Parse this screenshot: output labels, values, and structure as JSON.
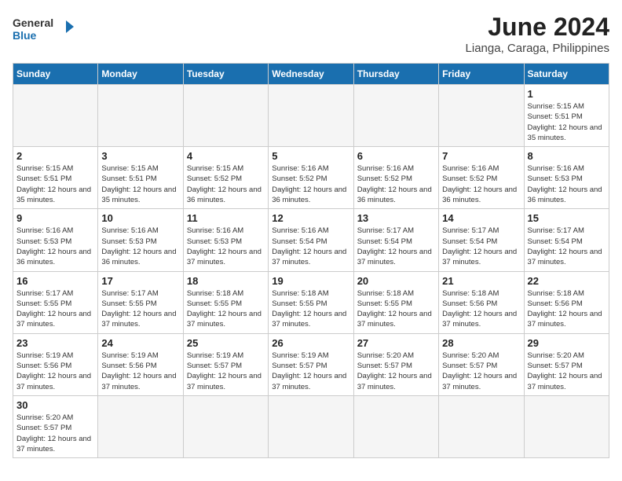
{
  "logo": {
    "text_general": "General",
    "text_blue": "Blue"
  },
  "title": "June 2024",
  "subtitle": "Lianga, Caraga, Philippines",
  "weekdays": [
    "Sunday",
    "Monday",
    "Tuesday",
    "Wednesday",
    "Thursday",
    "Friday",
    "Saturday"
  ],
  "weeks": [
    [
      {
        "day": "",
        "empty": true
      },
      {
        "day": "",
        "empty": true
      },
      {
        "day": "",
        "empty": true
      },
      {
        "day": "",
        "empty": true
      },
      {
        "day": "",
        "empty": true
      },
      {
        "day": "",
        "empty": true
      },
      {
        "day": "1",
        "sunrise": "5:15 AM",
        "sunset": "5:51 PM",
        "daylight": "12 hours and 35 minutes."
      }
    ],
    [
      {
        "day": "2",
        "sunrise": "5:15 AM",
        "sunset": "5:51 PM",
        "daylight": "12 hours and 35 minutes."
      },
      {
        "day": "3",
        "sunrise": "5:15 AM",
        "sunset": "5:51 PM",
        "daylight": "12 hours and 35 minutes."
      },
      {
        "day": "4",
        "sunrise": "5:15 AM",
        "sunset": "5:52 PM",
        "daylight": "12 hours and 36 minutes."
      },
      {
        "day": "5",
        "sunrise": "5:16 AM",
        "sunset": "5:52 PM",
        "daylight": "12 hours and 36 minutes."
      },
      {
        "day": "6",
        "sunrise": "5:16 AM",
        "sunset": "5:52 PM",
        "daylight": "12 hours and 36 minutes."
      },
      {
        "day": "7",
        "sunrise": "5:16 AM",
        "sunset": "5:52 PM",
        "daylight": "12 hours and 36 minutes."
      },
      {
        "day": "8",
        "sunrise": "5:16 AM",
        "sunset": "5:53 PM",
        "daylight": "12 hours and 36 minutes."
      }
    ],
    [
      {
        "day": "9",
        "sunrise": "5:16 AM",
        "sunset": "5:53 PM",
        "daylight": "12 hours and 36 minutes."
      },
      {
        "day": "10",
        "sunrise": "5:16 AM",
        "sunset": "5:53 PM",
        "daylight": "12 hours and 36 minutes."
      },
      {
        "day": "11",
        "sunrise": "5:16 AM",
        "sunset": "5:53 PM",
        "daylight": "12 hours and 37 minutes."
      },
      {
        "day": "12",
        "sunrise": "5:16 AM",
        "sunset": "5:54 PM",
        "daylight": "12 hours and 37 minutes."
      },
      {
        "day": "13",
        "sunrise": "5:17 AM",
        "sunset": "5:54 PM",
        "daylight": "12 hours and 37 minutes."
      },
      {
        "day": "14",
        "sunrise": "5:17 AM",
        "sunset": "5:54 PM",
        "daylight": "12 hours and 37 minutes."
      },
      {
        "day": "15",
        "sunrise": "5:17 AM",
        "sunset": "5:54 PM",
        "daylight": "12 hours and 37 minutes."
      }
    ],
    [
      {
        "day": "16",
        "sunrise": "5:17 AM",
        "sunset": "5:55 PM",
        "daylight": "12 hours and 37 minutes."
      },
      {
        "day": "17",
        "sunrise": "5:17 AM",
        "sunset": "5:55 PM",
        "daylight": "12 hours and 37 minutes."
      },
      {
        "day": "18",
        "sunrise": "5:18 AM",
        "sunset": "5:55 PM",
        "daylight": "12 hours and 37 minutes."
      },
      {
        "day": "19",
        "sunrise": "5:18 AM",
        "sunset": "5:55 PM",
        "daylight": "12 hours and 37 minutes."
      },
      {
        "day": "20",
        "sunrise": "5:18 AM",
        "sunset": "5:55 PM",
        "daylight": "12 hours and 37 minutes."
      },
      {
        "day": "21",
        "sunrise": "5:18 AM",
        "sunset": "5:56 PM",
        "daylight": "12 hours and 37 minutes."
      },
      {
        "day": "22",
        "sunrise": "5:18 AM",
        "sunset": "5:56 PM",
        "daylight": "12 hours and 37 minutes."
      }
    ],
    [
      {
        "day": "23",
        "sunrise": "5:19 AM",
        "sunset": "5:56 PM",
        "daylight": "12 hours and 37 minutes."
      },
      {
        "day": "24",
        "sunrise": "5:19 AM",
        "sunset": "5:56 PM",
        "daylight": "12 hours and 37 minutes."
      },
      {
        "day": "25",
        "sunrise": "5:19 AM",
        "sunset": "5:57 PM",
        "daylight": "12 hours and 37 minutes."
      },
      {
        "day": "26",
        "sunrise": "5:19 AM",
        "sunset": "5:57 PM",
        "daylight": "12 hours and 37 minutes."
      },
      {
        "day": "27",
        "sunrise": "5:20 AM",
        "sunset": "5:57 PM",
        "daylight": "12 hours and 37 minutes."
      },
      {
        "day": "28",
        "sunrise": "5:20 AM",
        "sunset": "5:57 PM",
        "daylight": "12 hours and 37 minutes."
      },
      {
        "day": "29",
        "sunrise": "5:20 AM",
        "sunset": "5:57 PM",
        "daylight": "12 hours and 37 minutes."
      }
    ],
    [
      {
        "day": "30",
        "sunrise": "5:20 AM",
        "sunset": "5:57 PM",
        "daylight": "12 hours and 37 minutes."
      },
      {
        "day": "",
        "empty": true
      },
      {
        "day": "",
        "empty": true
      },
      {
        "day": "",
        "empty": true
      },
      {
        "day": "",
        "empty": true
      },
      {
        "day": "",
        "empty": true
      },
      {
        "day": "",
        "empty": true
      }
    ]
  ],
  "labels": {
    "sunrise": "Sunrise:",
    "sunset": "Sunset:",
    "daylight": "Daylight:"
  }
}
